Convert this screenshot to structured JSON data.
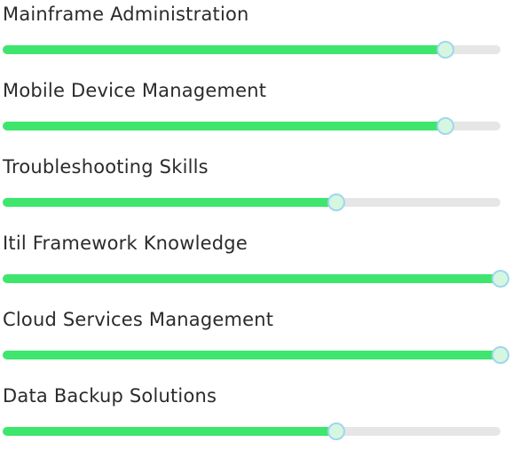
{
  "colors": {
    "fill": "#3ee66e",
    "track": "#e6e6e6",
    "thumb_border": "#9fd6f2",
    "thumb_fill": "#d6f7df",
    "label": "#2b2b2b"
  },
  "skills": [
    {
      "label": "Mainframe Administration",
      "value_pct": 89
    },
    {
      "label": "Mobile Device Management",
      "value_pct": 89
    },
    {
      "label": "Troubleshooting Skills",
      "value_pct": 67
    },
    {
      "label": "Itil Framework Knowledge",
      "value_pct": 100
    },
    {
      "label": "Cloud Services Management",
      "value_pct": 100
    },
    {
      "label": "Data Backup Solutions",
      "value_pct": 67
    }
  ]
}
